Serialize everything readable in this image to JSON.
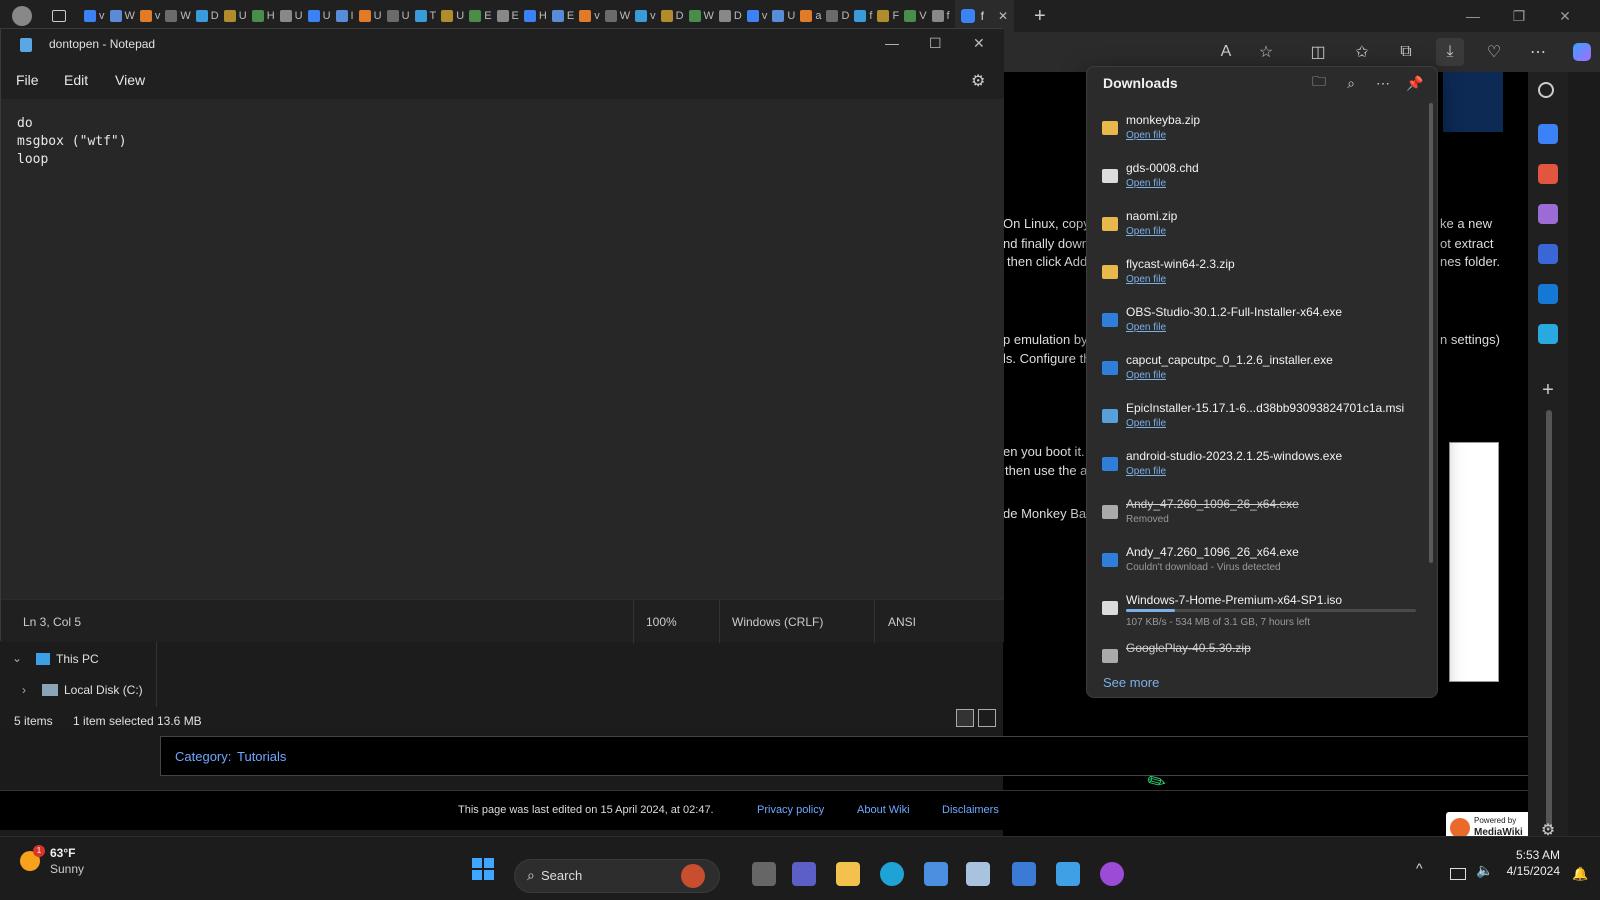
{
  "browser": {
    "tabs_visible": [
      "v",
      "W",
      "v",
      "W",
      "D",
      "U",
      "H",
      "U",
      "U",
      "I",
      "U",
      "U",
      "T",
      "U",
      "E",
      "E",
      "H",
      "E",
      "v",
      "W",
      "v",
      "D",
      "W",
      "D",
      "v",
      "U",
      "a",
      "D",
      "f",
      "F",
      "V",
      "f"
    ],
    "active_tab_label": "f"
  },
  "notepad": {
    "title": "dontopen - Notepad",
    "menus": [
      "File",
      "Edit",
      "View"
    ],
    "content_lines": [
      "do",
      "msgbox (\"wtf\")",
      "loop"
    ],
    "status": {
      "position": "Ln 3, Col 5",
      "zoom": "100%",
      "line_ending": "Windows (CRLF)",
      "encoding": "ANSI"
    }
  },
  "explorer": {
    "tree": [
      "This PC",
      "Local Disk (C:)"
    ],
    "status": {
      "items": "5 items",
      "selected": "1 item selected",
      "size": "13.6 MB"
    }
  },
  "webpage": {
    "fragments": [
      "On Linux, copy",
      "nd finally downl",
      "then click Add",
      "ke a new",
      "ot extract",
      "nes folder.",
      "p emulation by",
      "ls. Configure th",
      "n settings)",
      "en you boot it. A",
      "then use the a",
      "de Monkey Bal"
    ],
    "category_label": "Category:",
    "category_value": "Tutorials",
    "footer": {
      "last_edited": "This page was last edited on 15 April 2024, at 02:47.",
      "links": [
        "Privacy policy",
        "About Wiki",
        "Disclaimers"
      ],
      "badge_line1": "Powered by",
      "badge_line2": "MediaWiki"
    }
  },
  "downloads": {
    "title": "Downloads",
    "items": [
      {
        "name": "monkeyba.zip",
        "sub": "Open file",
        "type": "zip"
      },
      {
        "name": "gds-0008.chd",
        "sub": "Open file",
        "type": "file"
      },
      {
        "name": "naomi.zip",
        "sub": "Open file",
        "type": "zip"
      },
      {
        "name": "flycast-win64-2.3.zip",
        "sub": "Open file",
        "type": "zip"
      },
      {
        "name": "OBS-Studio-30.1.2-Full-Installer-x64.exe",
        "sub": "Open file",
        "type": "exe"
      },
      {
        "name": "capcut_capcutpc_0_1.2.6_installer.exe",
        "sub": "Open file",
        "type": "exe"
      },
      {
        "name": "EpicInstaller-15.17.1-6...d38bb93093824701c1a.msi",
        "sub": "Open file",
        "type": "msi"
      },
      {
        "name": "android-studio-2023.2.1.25-windows.exe",
        "sub": "Open file",
        "type": "exe"
      },
      {
        "name": "Andy_47.260_1096_26_x64.exe",
        "sub": "Removed",
        "type": "removed"
      },
      {
        "name": "Andy_47.260_1096_26_x64.exe",
        "sub": "Couldn't download - Virus detected",
        "type": "exe"
      },
      {
        "name": "Windows-7-Home-Premium-x64-SP1.iso",
        "sub": "107 KB/s - 534 MB of 3.1 GB, 7 hours left",
        "type": "progress",
        "progress": 0.17
      },
      {
        "name": "GooglePlay-40.5.30.zip",
        "sub": "",
        "type": "removed"
      }
    ],
    "see_more": "See more"
  },
  "taskbar": {
    "weather": {
      "temp": "63°F",
      "condition": "Sunny",
      "badge": "1"
    },
    "search_placeholder": "Search",
    "time": "5:53 AM",
    "date": "4/15/2024"
  },
  "colors": {
    "accent": "#0078d4",
    "link": "#7cb0e6",
    "folder": "#e8b84a"
  }
}
